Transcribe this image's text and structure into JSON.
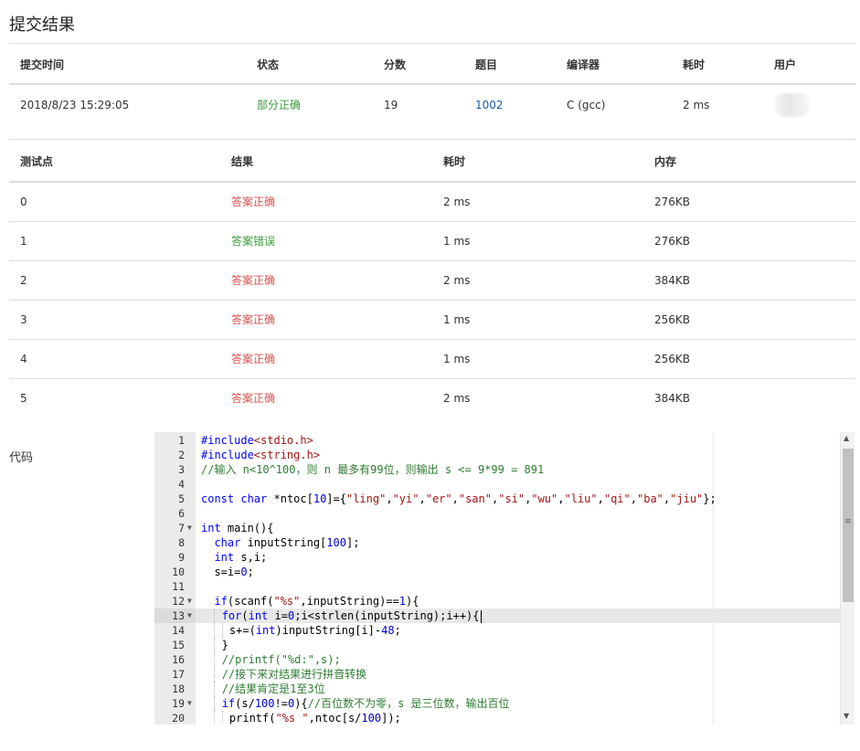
{
  "page_title": "提交结果",
  "submission": {
    "headers": [
      "提交时间",
      "状态",
      "分数",
      "题目",
      "编译器",
      "耗时",
      "用户"
    ],
    "time": "2018/8/23 15:29:05",
    "status": "部分正确",
    "score": "19",
    "problem": "1002",
    "compiler": "C (gcc)",
    "elapsed": "2 ms"
  },
  "tests": {
    "headers": [
      "测试点",
      "结果",
      "耗时",
      "内存"
    ],
    "rows": [
      {
        "id": "0",
        "result": "答案正确",
        "time": "2 ms",
        "memory": "276KB"
      },
      {
        "id": "1",
        "result": "答案错误",
        "time": "1 ms",
        "memory": "276KB"
      },
      {
        "id": "2",
        "result": "答案正确",
        "time": "2 ms",
        "memory": "384KB"
      },
      {
        "id": "3",
        "result": "答案正确",
        "time": "1 ms",
        "memory": "256KB"
      },
      {
        "id": "4",
        "result": "答案正确",
        "time": "1 ms",
        "memory": "256KB"
      },
      {
        "id": "5",
        "result": "答案正确",
        "time": "2 ms",
        "memory": "384KB"
      }
    ]
  },
  "code_label": "代码",
  "code_lines": [
    "#include<stdio.h>",
    "#include<string.h>",
    "//输入 n<10^100，则 n 最多有99位，则输出 s <= 9*99 = 891",
    "",
    "const char *ntoc[10]={\"ling\",\"yi\",\"er\",\"san\",\"si\",\"wu\",\"liu\",\"qi\",\"ba\",\"jiu\"};",
    "",
    "int main(){",
    "  char inputString[100];",
    "  int s,i;",
    "  s=i=0;",
    "",
    "  if(scanf(\"%s\",inputString)==1){",
    "    for(int i=0;i<strlen(inputString);i++){",
    "      s+=(int)inputString[i]-48;",
    "    }",
    "    //printf(\"%d:\",s);",
    "    //接下来对结果进行拼音转换",
    "    //结果肯定是1至3位",
    "    if(s/100!=0){//百位数不为零，s 是三位数，输出百位",
    "      printf(\"%s \",ntoc[s/100]);"
  ],
  "active_line": 13,
  "fold_lines": [
    7,
    12,
    13,
    19
  ],
  "colors": {
    "partial": "#3c9b3c",
    "correct": "#d9534f",
    "wrong": "#3c9b3c",
    "link": "#1a5aa8"
  },
  "icons": [
    "chevron-up-icon",
    "chevron-down-icon",
    "fold-arrow-icon",
    "grip-icon"
  ]
}
